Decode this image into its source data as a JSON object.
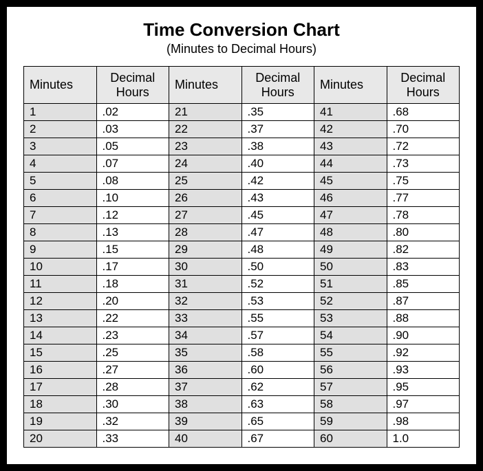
{
  "title": "Time Conversion Chart",
  "subtitle": "(Minutes to Decimal Hours)",
  "headers": {
    "minutes": "Minutes",
    "decimal_hours": "Decimal\nHours"
  },
  "chart_data": {
    "type": "table",
    "title": "Time Conversion Chart (Minutes to Decimal Hours)",
    "columns": [
      "Minutes",
      "Decimal Hours"
    ],
    "rows": [
      [
        1,
        ".02"
      ],
      [
        2,
        ".03"
      ],
      [
        3,
        ".05"
      ],
      [
        4,
        ".07"
      ],
      [
        5,
        ".08"
      ],
      [
        6,
        ".10"
      ],
      [
        7,
        ".12"
      ],
      [
        8,
        ".13"
      ],
      [
        9,
        ".15"
      ],
      [
        10,
        ".17"
      ],
      [
        11,
        ".18"
      ],
      [
        12,
        ".20"
      ],
      [
        13,
        ".22"
      ],
      [
        14,
        ".23"
      ],
      [
        15,
        ".25"
      ],
      [
        16,
        ".27"
      ],
      [
        17,
        ".28"
      ],
      [
        18,
        ".30"
      ],
      [
        19,
        ".32"
      ],
      [
        20,
        ".33"
      ],
      [
        21,
        ".35"
      ],
      [
        22,
        ".37"
      ],
      [
        23,
        ".38"
      ],
      [
        24,
        ".40"
      ],
      [
        25,
        ".42"
      ],
      [
        26,
        ".43"
      ],
      [
        27,
        ".45"
      ],
      [
        28,
        ".47"
      ],
      [
        29,
        ".48"
      ],
      [
        30,
        ".50"
      ],
      [
        31,
        ".52"
      ],
      [
        32,
        ".53"
      ],
      [
        33,
        ".55"
      ],
      [
        34,
        ".57"
      ],
      [
        35,
        ".58"
      ],
      [
        36,
        ".60"
      ],
      [
        37,
        ".62"
      ],
      [
        38,
        ".63"
      ],
      [
        39,
        ".65"
      ],
      [
        40,
        ".67"
      ],
      [
        41,
        ".68"
      ],
      [
        42,
        ".70"
      ],
      [
        43,
        ".72"
      ],
      [
        44,
        ".73"
      ],
      [
        45,
        ".75"
      ],
      [
        46,
        ".77"
      ],
      [
        47,
        ".78"
      ],
      [
        48,
        ".80"
      ],
      [
        49,
        ".82"
      ],
      [
        50,
        ".83"
      ],
      [
        51,
        ".85"
      ],
      [
        52,
        ".87"
      ],
      [
        53,
        ".88"
      ],
      [
        54,
        ".90"
      ],
      [
        55,
        ".92"
      ],
      [
        56,
        ".93"
      ],
      [
        57,
        ".95"
      ],
      [
        58,
        ".97"
      ],
      [
        59,
        ".98"
      ],
      [
        60,
        "1.0"
      ]
    ]
  }
}
